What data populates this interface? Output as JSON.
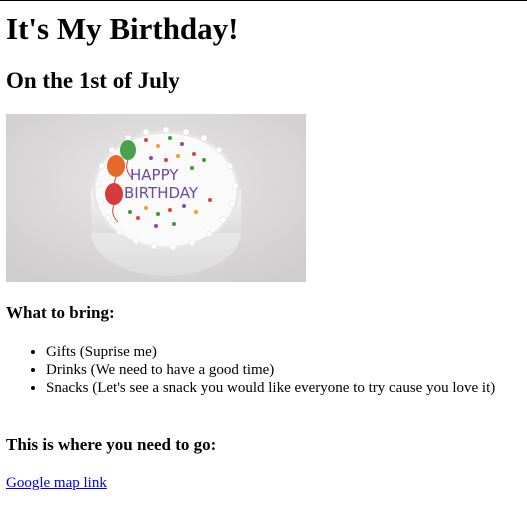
{
  "page": {
    "title": "It's My Birthday!",
    "subtitle": "On the 1st of July"
  },
  "image": {
    "cake_text_line1": "HAPPY",
    "cake_text_line2": "BIRTHDAY"
  },
  "bring": {
    "heading": "What to bring:",
    "items": [
      "Gifts (Suprise me)",
      "Drinks (We need to have a good time)",
      "Snacks (Let's see a snack you would like everyone to try cause you love it)"
    ]
  },
  "location": {
    "heading": "This is where you need to go:",
    "link_text": "Google map link"
  },
  "colors": {
    "link": "#0000ee",
    "text": "#000000",
    "background": "#ffffff"
  }
}
